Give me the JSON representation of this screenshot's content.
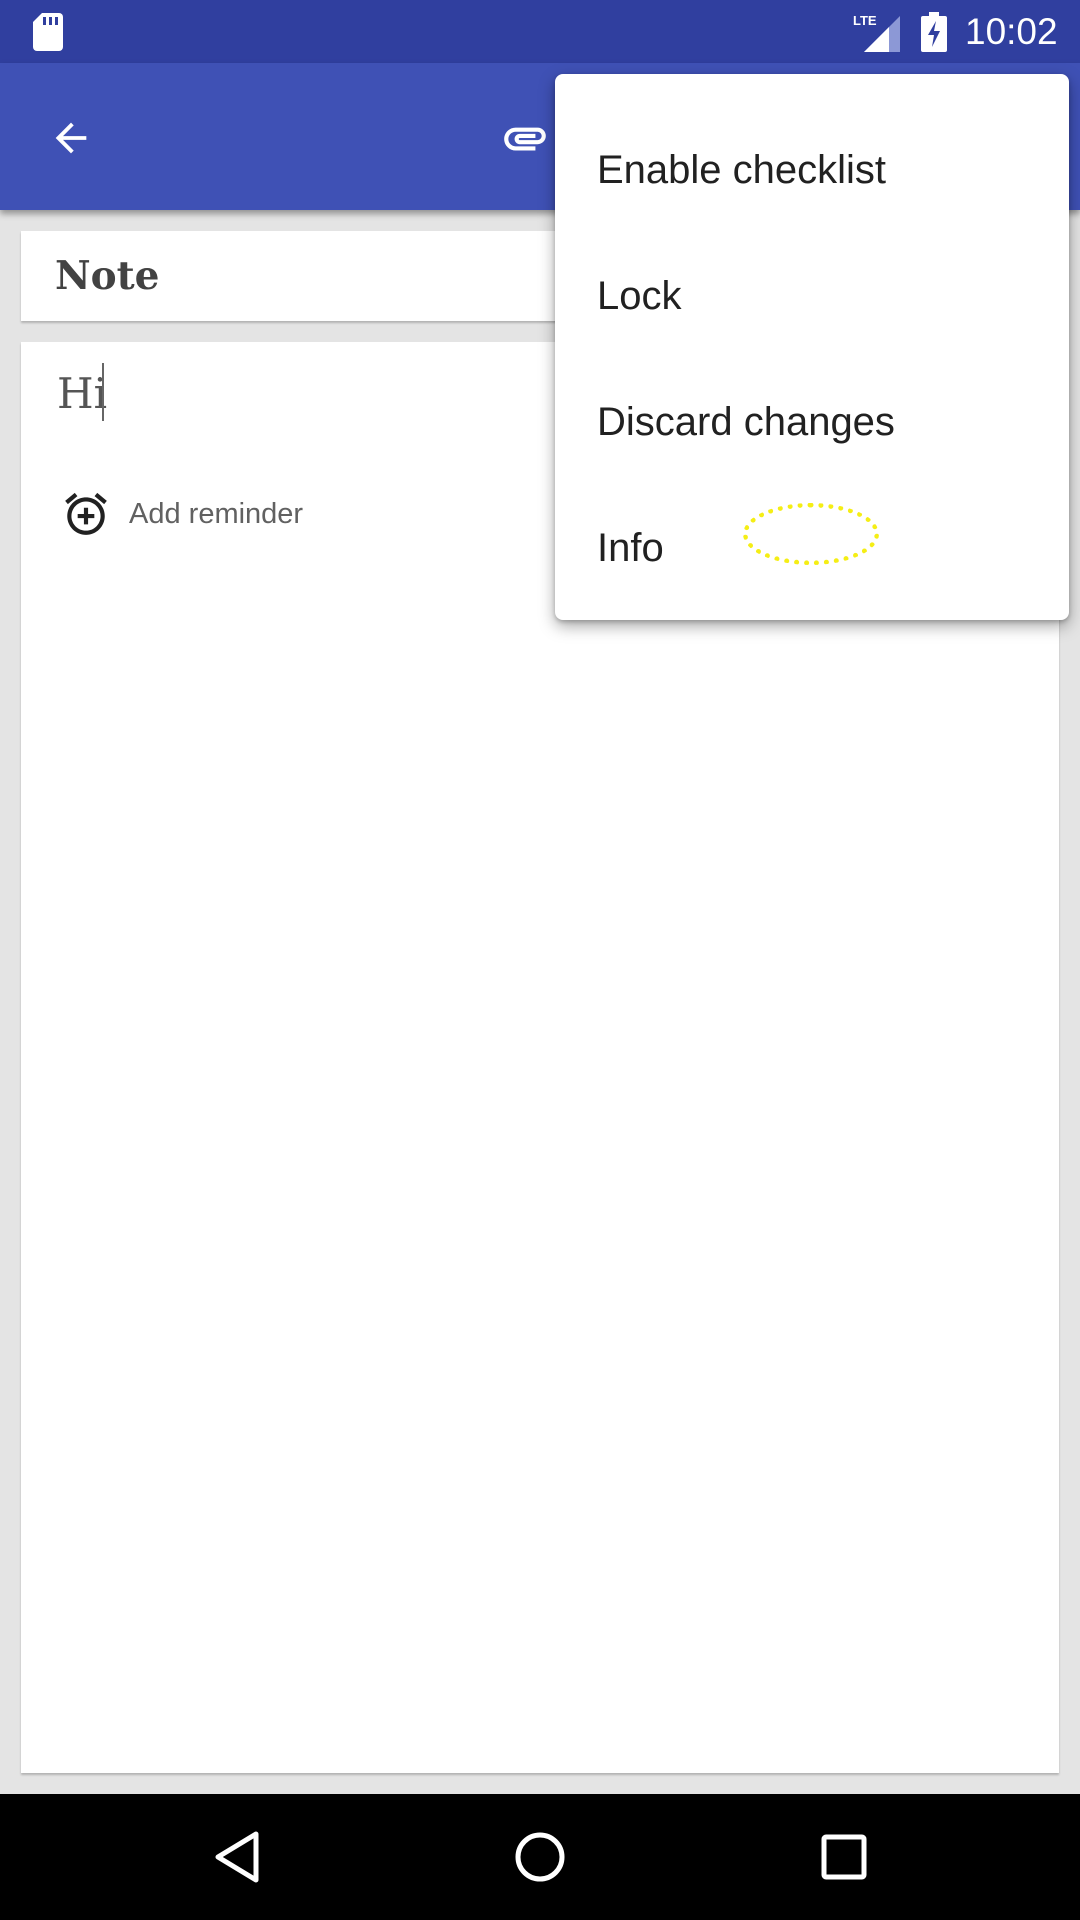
{
  "status_bar": {
    "time": "10:02",
    "icons": [
      "sd-card-icon",
      "lte-signal-icon",
      "battery-charging-icon"
    ],
    "background_color": "#303f9f"
  },
  "app_bar": {
    "background_color": "#3f51b5",
    "icons": [
      "back-arrow-icon",
      "paperclip-icon"
    ]
  },
  "note": {
    "title": "Note",
    "body": "Hi",
    "add_reminder_label": "Add reminder"
  },
  "menu": {
    "items": [
      {
        "label": "Enable checklist"
      },
      {
        "label": "Lock"
      },
      {
        "label": "Discard changes"
      },
      {
        "label": "Info"
      }
    ]
  },
  "highlight_color": "#f5ee15",
  "nav_bar": {
    "icons": [
      "nav-back-icon",
      "nav-home-icon",
      "nav-recents-icon"
    ]
  }
}
